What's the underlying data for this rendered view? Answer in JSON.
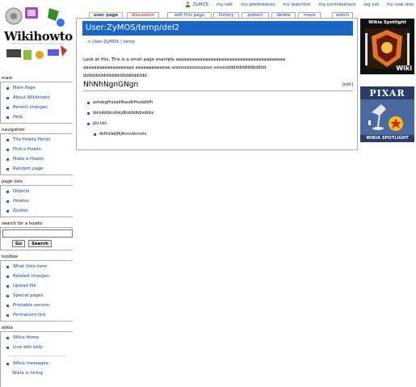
{
  "personal_tools": {
    "username": "ZyMOS",
    "items": [
      "my talk",
      "my preferences",
      "my watchlist",
      "my contributions",
      "log out",
      "try new skin"
    ]
  },
  "logo": {
    "text": "Wikihowto"
  },
  "tabs": {
    "user_page": "user page",
    "discussion": "discussion",
    "edit": "edit this page",
    "history": "history",
    "protect": "protect",
    "delete": "delete",
    "move": "move",
    "watch": "watch"
  },
  "page": {
    "title": "User:ZyMOS/temp/del2",
    "subtitle_prefix": "< ",
    "subtitle_links": [
      "User:ZyMOS",
      "temp"
    ],
    "subtitle_sep": " | ",
    "body_text": "Look at this, This is a small page example aaaaaaaaaaaaaaaaaaaaaaaaaaaaaaaaaaaaaaaaa aaaaaaaaaaaaaaaaaaa aaaaaaaaaaaaa ssssssssssssssssss ssssssdddddddddddddd ddddddddddddddddddddddd",
    "heading": "NhNhNgnGNgn",
    "edit_label": "edit",
    "list": [
      "ashdsgfhsdakfkasdhfhsdalkfh",
      "ibkivbkbkvibkjdbvkbdkbvdkbv",
      "jkn,lsls"
    ],
    "sublist": [
      "dsfhslsdjfkjlknsvlknvslv"
    ]
  },
  "sidebar": {
    "main": {
      "title": "main",
      "items": [
        "Main Page",
        "About Wikihowto",
        "Recent changes",
        "Help"
      ]
    },
    "navigation": {
      "title": "navigation",
      "items": [
        "The Howto Portal",
        "Find a Howto",
        "Make a Howto",
        "Random page"
      ]
    },
    "page_lists": {
      "title": "page lists",
      "items": [
        "Objects",
        "Howtos",
        "Guides"
      ]
    },
    "search": {
      "title": "search for a howto",
      "go": "Go",
      "search": "Search",
      "value": ""
    },
    "toolbox": {
      "title": "toolbox",
      "items": [
        "What links here",
        "Related changes",
        "Upload file",
        "Special pages",
        "Printable version",
        "Permanent link"
      ]
    },
    "wikia": {
      "title": "wikia",
      "items": [
        "Wikia Home",
        "Live wiki help"
      ],
      "messages": "Wikia messages:",
      "hiring": "Wikia is hiring"
    }
  },
  "ads": {
    "spotlight1": {
      "label": "Wikia Spotlight",
      "brand": "Wiki"
    },
    "spotlight2": {
      "label": "PIXAR",
      "footer": "WIKIA SPOTLIGHT"
    }
  },
  "colors": {
    "link": "#0645ad",
    "titlebar": "#1a66c2",
    "new_link": "#ba0000"
  }
}
